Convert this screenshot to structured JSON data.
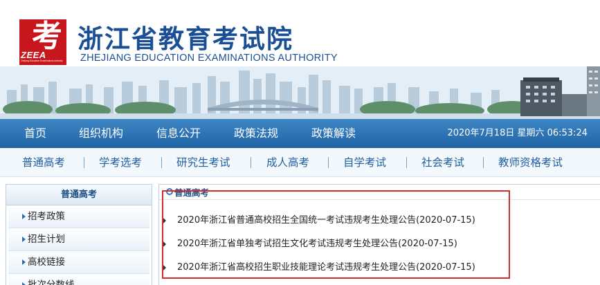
{
  "header": {
    "logo_glyph": "考",
    "logo_abbr": "ZEEA",
    "logo_small_text": "Zhejiang Education Examinations Authority",
    "title_cn": "浙江省教育考试院",
    "title_en": "ZHEJIANG EDUCATION EXAMINATIONS AUTHORITY"
  },
  "main_nav": {
    "items": [
      "首页",
      "组织机构",
      "信息公开",
      "政策法规",
      "政策解读"
    ],
    "datetime": "2020年7月18日 星期六 06:53:24"
  },
  "sub_nav": {
    "items": [
      "普通高考",
      "学考选考",
      "研究生考试",
      "成人高考",
      "自学考试",
      "社会考试",
      "教师资格考试"
    ]
  },
  "sidebar": {
    "title": "普通高考",
    "items": [
      "招考政策",
      "招生计划",
      "高校链接",
      "批次分数线"
    ]
  },
  "news": {
    "section_title": "普通高考",
    "items": [
      "2020年浙江省普通高校招生全国统一考试违规考生处理公告(2020-07-15)",
      "2020年浙江省单独考试招生文化考试违规考生处理公告(2020-07-15)",
      "2020年浙江省高校招生职业技能理论考试违规考生处理公告(2020-07-15)"
    ]
  },
  "colors": {
    "brand_blue": "#1a4f96",
    "nav_blue": "#2a70b3",
    "logo_red": "#c8161d",
    "highlight_red": "#d62b2b"
  }
}
